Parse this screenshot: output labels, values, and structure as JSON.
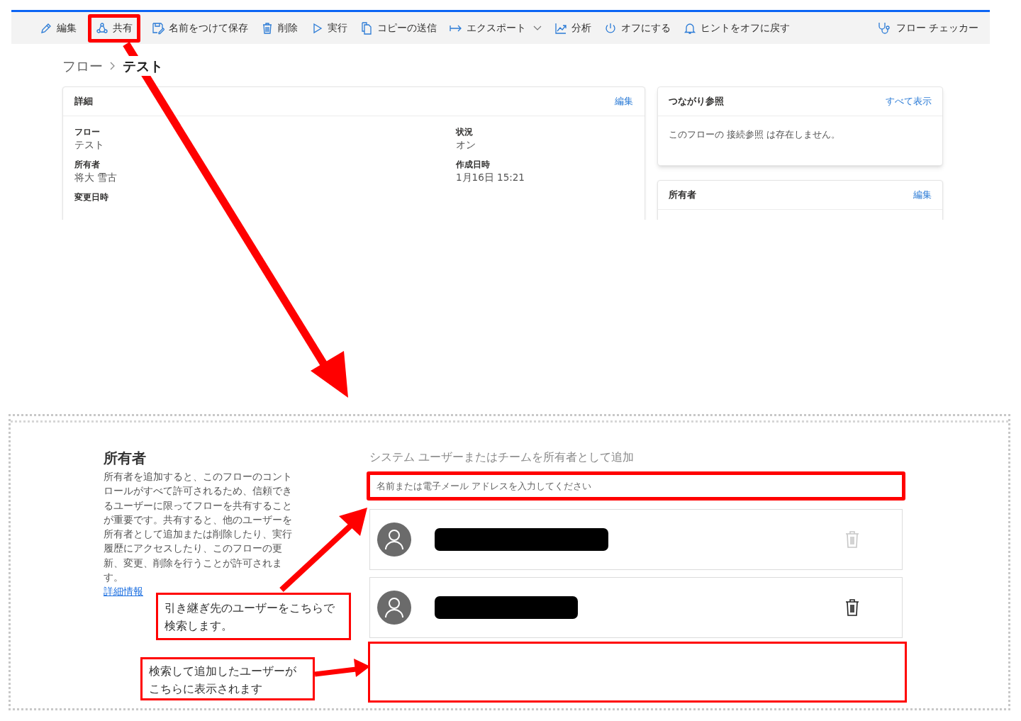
{
  "toolbar": [
    {
      "label": "編集",
      "kind": "pencil",
      "highlighted": false,
      "dropdown": false
    },
    {
      "label": "共有",
      "kind": "share",
      "highlighted": true,
      "dropdown": false
    },
    {
      "label": "名前をつけて保存",
      "kind": "save",
      "highlighted": false,
      "dropdown": false
    },
    {
      "label": "削除",
      "kind": "trash",
      "highlighted": false,
      "dropdown": false
    },
    {
      "label": "実行",
      "kind": "play",
      "highlighted": false,
      "dropdown": false
    },
    {
      "label": "コピーの送信",
      "kind": "copy",
      "highlighted": false,
      "dropdown": false
    },
    {
      "label": "エクスポート",
      "kind": "export",
      "highlighted": false,
      "dropdown": true
    },
    {
      "label": "分析",
      "kind": "chart",
      "highlighted": false,
      "dropdown": false
    },
    {
      "label": "オフにする",
      "kind": "power",
      "highlighted": false,
      "dropdown": false
    },
    {
      "label": "ヒントをオフに戻す",
      "kind": "bell",
      "highlighted": false,
      "dropdown": false
    }
  ],
  "flow_checker": "フロー チェッカー",
  "breadcrumb": [
    "フロー",
    "テスト"
  ],
  "details": {
    "title": "詳細",
    "action": "編集",
    "fields": [
      {
        "label": "フロー",
        "value": "テスト"
      },
      {
        "label": "状況",
        "value": "オン"
      },
      {
        "label": "所有者",
        "value": "将大 雪古"
      },
      {
        "label": "作成日時",
        "value": "1月16日 15:21"
      },
      {
        "label": "変更日時"
      }
    ]
  },
  "connections": {
    "title": "つながり参照",
    "action": "すべて表示",
    "message": "このフローの 接続参照 は存在しません。"
  },
  "owners_card": {
    "title": "所有者",
    "action": "編集"
  },
  "share_panel": {
    "title": "所有者",
    "description": "所有者を追加すると、このフローのコントロールがすべて許可されるため、信頼できるユーザーに限ってフローを共有することが重要です。共有すると、他のユーザーを所有者として追加または削除したり、実行履歴にアクセスしたり、このフローの更新、変更、削除を行うことが許可されます。",
    "link": "詳細情報",
    "add_heading": "システム ユーザーまたはチームを所有者として追加",
    "search": {
      "placeholder": "名前または電子メール アドレスを入力してください"
    },
    "users": [
      {
        "delete_disabled": true
      },
      {
        "delete_disabled": false
      }
    ]
  },
  "callouts": [
    "引き継ぎ先のユーザーをこちらで検索します。",
    "検索して追加したユーザーがこちらに表示されます"
  ]
}
